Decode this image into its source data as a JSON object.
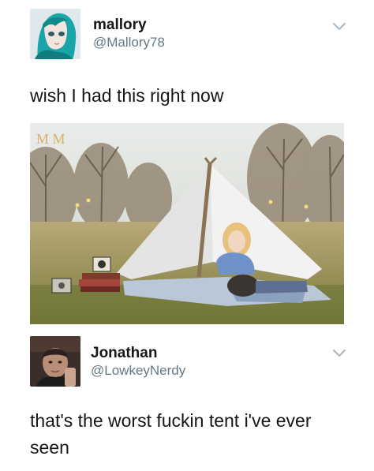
{
  "tweets": [
    {
      "display_name": "mallory",
      "handle": "@Mallory78",
      "text": "wish I had this right now",
      "avatar_icon": "anime-avatar-teal-hair"
    },
    {
      "display_name": "Jonathan",
      "handle": "@LowkeyNerdy",
      "text": "that's the worst fuckin tent i've ever seen",
      "avatar_icon": "selfie-avatar"
    }
  ],
  "photo": {
    "subject": "couple-in-tent-photo",
    "watermark": "M M"
  },
  "colors": {
    "text": "#14171a",
    "secondary": "#657786",
    "chevron": "#aab8c2",
    "watermark": "#d8b06a"
  }
}
